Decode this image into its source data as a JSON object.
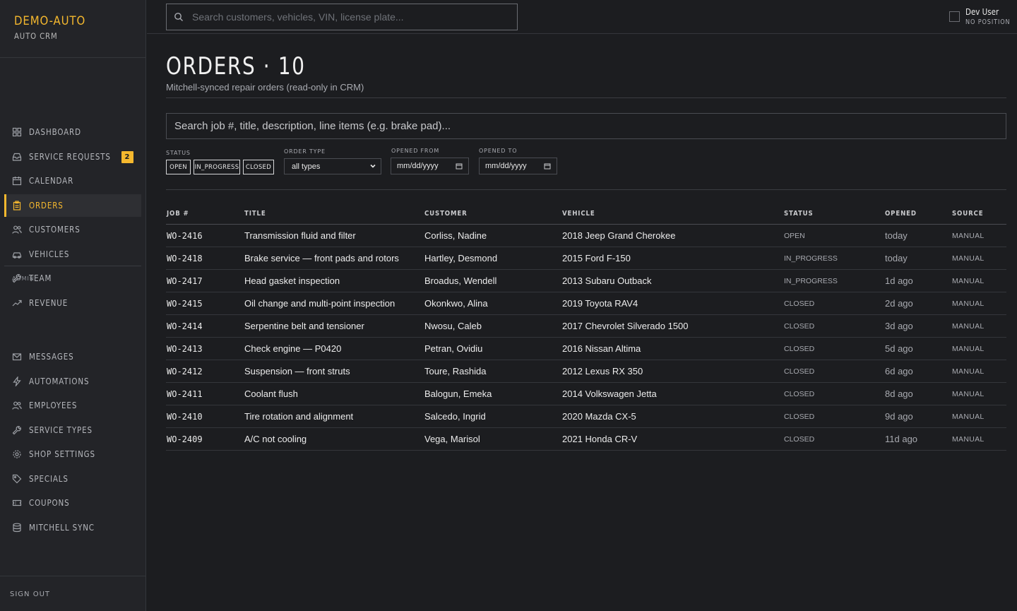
{
  "brand": {
    "name": "DEMO-AUTO",
    "subtitle": "AUTO CRM"
  },
  "sidebar": {
    "items": [
      {
        "label": "DASHBOARD",
        "icon": "grid-icon"
      },
      {
        "label": "SERVICE REQUESTS",
        "icon": "inbox-icon",
        "badge": "2"
      },
      {
        "label": "CALENDAR",
        "icon": "calendar-icon"
      },
      {
        "label": "ORDERS",
        "icon": "clipboard-icon",
        "active": true
      },
      {
        "label": "CUSTOMERS",
        "icon": "users-icon"
      },
      {
        "label": "VEHICLES",
        "icon": "car-icon"
      },
      {
        "label": "TEAM",
        "icon": "wrench-icon"
      },
      {
        "label": "REVENUE",
        "icon": "trend-icon"
      }
    ],
    "admin_label": "ADMIN",
    "admin_items": [
      {
        "label": "MESSAGES",
        "icon": "mail-icon"
      },
      {
        "label": "AUTOMATIONS",
        "icon": "bolt-icon"
      },
      {
        "label": "EMPLOYEES",
        "icon": "users-icon"
      },
      {
        "label": "SERVICE TYPES",
        "icon": "wrench-icon"
      },
      {
        "label": "SHOP SETTINGS",
        "icon": "gear-icon"
      },
      {
        "label": "SPECIALS",
        "icon": "tag-icon"
      },
      {
        "label": "COUPONS",
        "icon": "ticket-icon"
      },
      {
        "label": "MITCHELL SYNC",
        "icon": "database-icon"
      }
    ],
    "signout_label": "SIGN OUT"
  },
  "topbar": {
    "search_placeholder": "Search customers, vehicles, VIN, license plate...",
    "user_name": "Dev User",
    "user_role": "NO POSITION"
  },
  "page": {
    "title": "ORDERS · 10",
    "subtitle": "Mitchell-synced repair orders (read-only in CRM)",
    "search_placeholder": "Search job #, title, description, line items (e.g. brake pad)..."
  },
  "filters": {
    "status_label": "STATUS",
    "status_chips": [
      "OPEN",
      "IN_PROGRESS",
      "CLOSED"
    ],
    "order_type_label": "ORDER TYPE",
    "order_type_value": "all types",
    "opened_from_label": "OPENED FROM",
    "opened_from_value": "mm/dd/yyyy",
    "opened_to_label": "OPENED TO",
    "opened_to_value": "mm/dd/yyyy"
  },
  "table": {
    "headers": [
      "JOB #",
      "TITLE",
      "CUSTOMER",
      "VEHICLE",
      "STATUS",
      "OPENED",
      "SOURCE"
    ],
    "rows": [
      [
        "WO-2416",
        "Transmission fluid and filter",
        "Corliss, Nadine",
        "2018 Jeep Grand Cherokee",
        "OPEN",
        "today",
        "MANUAL"
      ],
      [
        "WO-2418",
        "Brake service — front pads and rotors",
        "Hartley, Desmond",
        "2015 Ford F-150",
        "IN_PROGRESS",
        "today",
        "MANUAL"
      ],
      [
        "WO-2417",
        "Head gasket inspection",
        "Broadus, Wendell",
        "2013 Subaru Outback",
        "IN_PROGRESS",
        "1d ago",
        "MANUAL"
      ],
      [
        "WO-2415",
        "Oil change and multi-point inspection",
        "Okonkwo, Alina",
        "2019 Toyota RAV4",
        "CLOSED",
        "2d ago",
        "MANUAL"
      ],
      [
        "WO-2414",
        "Serpentine belt and tensioner",
        "Nwosu, Caleb",
        "2017 Chevrolet Silverado 1500",
        "CLOSED",
        "3d ago",
        "MANUAL"
      ],
      [
        "WO-2413",
        "Check engine — P0420",
        "Petran, Ovidiu",
        "2016 Nissan Altima",
        "CLOSED",
        "5d ago",
        "MANUAL"
      ],
      [
        "WO-2412",
        "Suspension — front struts",
        "Toure, Rashida",
        "2012 Lexus RX 350",
        "CLOSED",
        "6d ago",
        "MANUAL"
      ],
      [
        "WO-2411",
        "Coolant flush",
        "Balogun, Emeka",
        "2014 Volkswagen Jetta",
        "CLOSED",
        "8d ago",
        "MANUAL"
      ],
      [
        "WO-2410",
        "Tire rotation and alignment",
        "Salcedo, Ingrid",
        "2020 Mazda CX-5",
        "CLOSED",
        "9d ago",
        "MANUAL"
      ],
      [
        "WO-2409",
        "A/C not cooling",
        "Vega, Marisol",
        "2021 Honda CR-V",
        "CLOSED",
        "11d ago",
        "MANUAL"
      ]
    ]
  },
  "colors": {
    "accent": "#f5b82e",
    "background": "#1c1d20",
    "sidebar": "#232428"
  }
}
